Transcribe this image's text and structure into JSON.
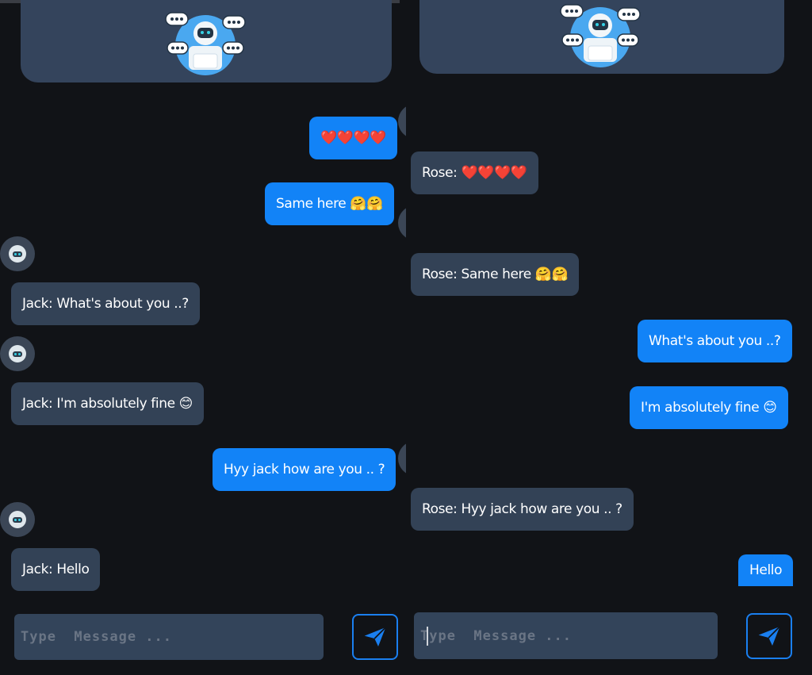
{
  "left_chat": {
    "messages": [
      {
        "text": "❤️❤️❤️❤️"
      },
      {
        "text": "Same here 🤗🤗"
      },
      {
        "text": "Jack: What's about you ..?"
      },
      {
        "text": "Jack: I'm absolutely fine 😊"
      },
      {
        "text": "Hyy jack how are you .. ?"
      },
      {
        "text": "Jack: Hello"
      }
    ],
    "input": {
      "placeholder": "Type  Message ..."
    }
  },
  "right_chat": {
    "messages": [
      {
        "text": "Rose: ❤️❤️❤️❤️"
      },
      {
        "text": "Rose: Same here 🤗🤗"
      },
      {
        "text": "What's about you ..?"
      },
      {
        "text": "I'm absolutely fine 😊"
      },
      {
        "text": "Rose: Hyy jack how are you .. ?"
      },
      {
        "text": "Hello"
      }
    ],
    "input": {
      "placeholder": "Type  Message ..."
    }
  },
  "icons": {
    "banner": "chatbot-illustration-icon",
    "avatar": "bot-avatar-icon",
    "send": "send-paper-plane-icon"
  },
  "colors": {
    "outgoing_bubble": "#1283f7",
    "incoming_bubble": "#334256",
    "background": "#111317",
    "banner": "#34445c",
    "send_border": "#1a7ff0"
  }
}
